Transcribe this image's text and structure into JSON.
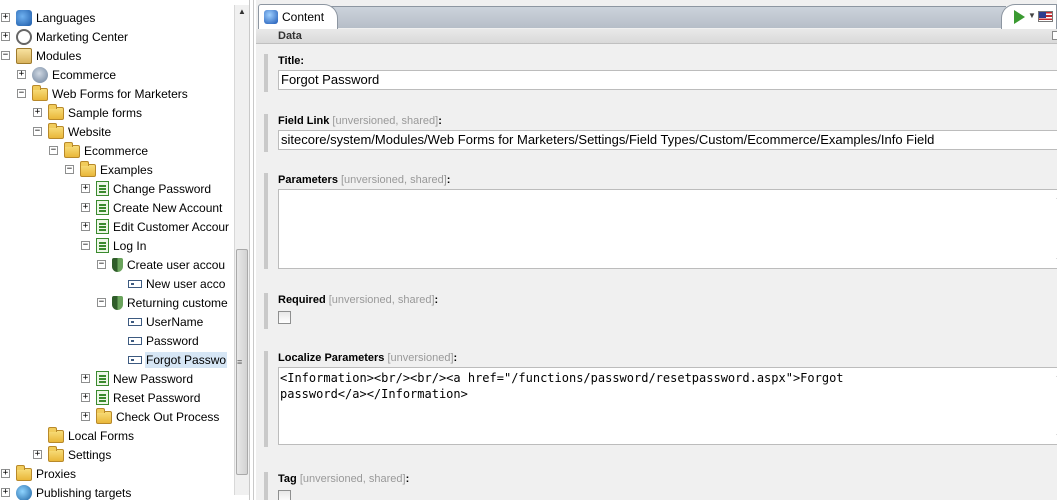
{
  "tree": {
    "items": [
      {
        "label": "Languages",
        "icon": "globe-icon",
        "expander": "+"
      },
      {
        "label": "Marketing Center",
        "icon": "marketing-icon",
        "expander": "+"
      },
      {
        "label": "Modules",
        "icon": "modules-icon",
        "expander": "−"
      },
      {
        "label": "Ecommerce",
        "icon": "ecommerce-icon",
        "expander": "+"
      },
      {
        "label": "Web Forms for Marketers",
        "icon": "folder-icon",
        "expander": "−"
      },
      {
        "label": "Sample forms",
        "icon": "folder-icon",
        "expander": "+"
      },
      {
        "label": "Website",
        "icon": "folder-icon",
        "expander": "−"
      },
      {
        "label": "Ecommerce",
        "icon": "folder-icon",
        "expander": "−"
      },
      {
        "label": "Examples",
        "icon": "folder-icon",
        "expander": "−"
      },
      {
        "label": "Change Password",
        "icon": "form-icon",
        "expander": "+"
      },
      {
        "label": "Create New Account",
        "icon": "form-icon",
        "expander": "+"
      },
      {
        "label": "Edit Customer Accour",
        "icon": "form-icon",
        "expander": "+"
      },
      {
        "label": "Log In",
        "icon": "form-icon",
        "expander": "−"
      },
      {
        "label": "Create user accou",
        "icon": "section-icon",
        "expander": "−"
      },
      {
        "label": "New user acco",
        "icon": "field-icon",
        "expander": ""
      },
      {
        "label": "Returning custome",
        "icon": "section-icon",
        "expander": "−"
      },
      {
        "label": "UserName",
        "icon": "field-icon",
        "expander": ""
      },
      {
        "label": "Password",
        "icon": "field-icon",
        "expander": ""
      },
      {
        "label": "Forgot Passwo",
        "icon": "field-icon",
        "expander": "",
        "selected": true
      },
      {
        "label": "New Password",
        "icon": "form-icon",
        "expander": "+"
      },
      {
        "label": "Reset Password",
        "icon": "form-icon",
        "expander": "+"
      },
      {
        "label": "Check Out Process",
        "icon": "folder-icon",
        "expander": "+"
      },
      {
        "label": "Local Forms",
        "icon": "folder-icon",
        "expander": ""
      },
      {
        "label": "Settings",
        "icon": "folder-icon",
        "expander": "+"
      },
      {
        "label": "Proxies",
        "icon": "folder-icon",
        "expander": "+"
      },
      {
        "label": "Publishing targets",
        "icon": "publish-icon",
        "expander": "+"
      }
    ]
  },
  "tab": {
    "label": "Content"
  },
  "section": {
    "title": "Data"
  },
  "fields": {
    "title": {
      "label": "Title:",
      "value": "Forgot Password"
    },
    "field_link": {
      "label": "Field Link",
      "note": "[unversioned, shared]",
      "colon": ":",
      "value": "sitecore/system/Modules/Web Forms for Marketers/Settings/Field Types/Custom/Ecommerce/Examples/Info Field"
    },
    "parameters": {
      "label": "Parameters",
      "note": "[unversioned, shared]",
      "colon": ":",
      "value": ""
    },
    "required": {
      "label": "Required",
      "note": "[unversioned, shared]",
      "colon": ":",
      "checked": false
    },
    "localize_parameters": {
      "label": "Localize Parameters",
      "note": "[unversioned]",
      "colon": ":",
      "value": "<Information><br/><br/><a href=\"/functions/password/resetpassword.aspx\">Forgot\npassword</a></Information>"
    },
    "tag": {
      "label": "Tag",
      "note": "[unversioned, shared]",
      "colon": ":",
      "checked": false
    }
  }
}
